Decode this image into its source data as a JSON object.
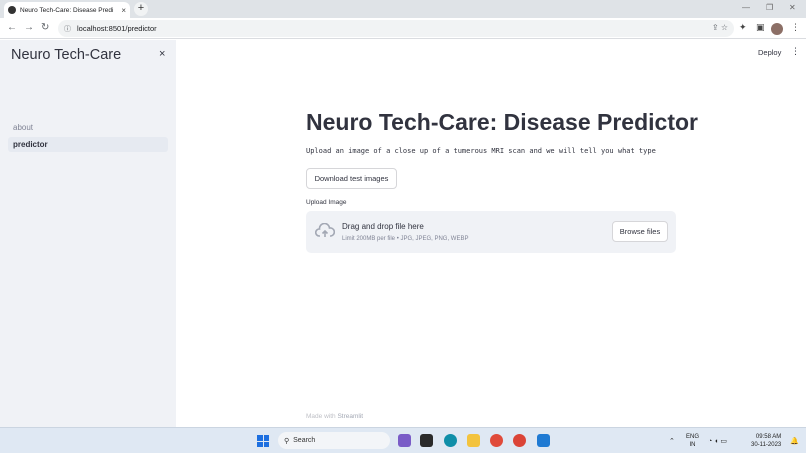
{
  "browser": {
    "tab_title": "Neuro Tech-Care: Disease Predi",
    "tab_close": "×",
    "new_tab": "+",
    "url": "localhost:8501/predictor"
  },
  "sidebar": {
    "title": "Neuro Tech-Care",
    "close": "×",
    "items": [
      {
        "label": "about",
        "active": false
      },
      {
        "label": "predictor",
        "active": true
      }
    ]
  },
  "header": {
    "deploy": "Deploy",
    "menu": "⋮"
  },
  "main": {
    "title": "Neuro Tech-Care: Disease Predictor",
    "description": "Upload an image of a close up of a tumerous MRI scan and we will tell you what type",
    "download_button": "Download test images",
    "upload_label": "Upload Image",
    "dropzone_title": "Drag and drop file here",
    "dropzone_subtitle": "Limit 200MB per file • JPG, JPEG, PNG, WEBP",
    "browse_button": "Browse files"
  },
  "footer": {
    "made_with": "Made with",
    "brand": "Streamlit"
  },
  "taskbar": {
    "search": "Search",
    "lang_top": "ENG",
    "lang_bottom": "IN",
    "time": "09:58 AM",
    "date": "30-11-2023"
  },
  "colors": {
    "sidebar_bg": "#f0f2f6",
    "text": "#31333f",
    "muted": "#808495"
  }
}
